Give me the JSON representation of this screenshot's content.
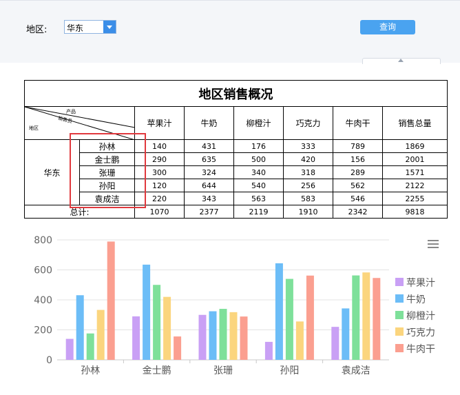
{
  "filter": {
    "region_label": "地区:",
    "region_value": "华东",
    "query_label": "查询"
  },
  "report": {
    "title": "地区销售概况",
    "corner": {
      "product": "产品",
      "salesperson": "销售员",
      "region": "地区"
    },
    "headers": [
      "苹果汁",
      "牛奶",
      "柳橙汁",
      "巧克力",
      "牛肉干",
      "销售总量"
    ],
    "region": "华东",
    "rows": [
      {
        "name": "孙林",
        "values": [
          "140",
          "431",
          "176",
          "333",
          "789",
          "1869"
        ]
      },
      {
        "name": "金士鹏",
        "values": [
          "290",
          "635",
          "500",
          "420",
          "156",
          "2001"
        ]
      },
      {
        "name": "张珊",
        "values": [
          "300",
          "324",
          "340",
          "318",
          "289",
          "1571"
        ]
      },
      {
        "name": "孙阳",
        "values": [
          "120",
          "644",
          "540",
          "256",
          "562",
          "2122"
        ]
      },
      {
        "name": "袁成洁",
        "values": [
          "220",
          "343",
          "563",
          "583",
          "546",
          "2255"
        ]
      }
    ],
    "total_label": "总计:",
    "totals": [
      "1070",
      "2377",
      "2119",
      "1910",
      "2342",
      "9818"
    ]
  },
  "chart_data": {
    "type": "bar",
    "categories": [
      "孙林",
      "金士鹏",
      "张珊",
      "孙阳",
      "袁成洁"
    ],
    "series": [
      {
        "name": "苹果汁",
        "values": [
          140,
          290,
          300,
          120,
          220
        ],
        "color": "#c9a0f5"
      },
      {
        "name": "牛奶",
        "values": [
          431,
          635,
          324,
          644,
          343
        ],
        "color": "#6cbdf7"
      },
      {
        "name": "柳橙汁",
        "values": [
          176,
          500,
          340,
          540,
          563
        ],
        "color": "#7ee09a"
      },
      {
        "name": "巧克力",
        "values": [
          333,
          420,
          318,
          256,
          583
        ],
        "color": "#fbd57e"
      },
      {
        "name": "牛肉干",
        "values": [
          789,
          156,
          289,
          562,
          546
        ],
        "color": "#fb9f90"
      }
    ],
    "yticks": [
      "0",
      "200",
      "400",
      "600",
      "800"
    ],
    "ylim": [
      0,
      800
    ],
    "grid": true,
    "legend": "right"
  }
}
